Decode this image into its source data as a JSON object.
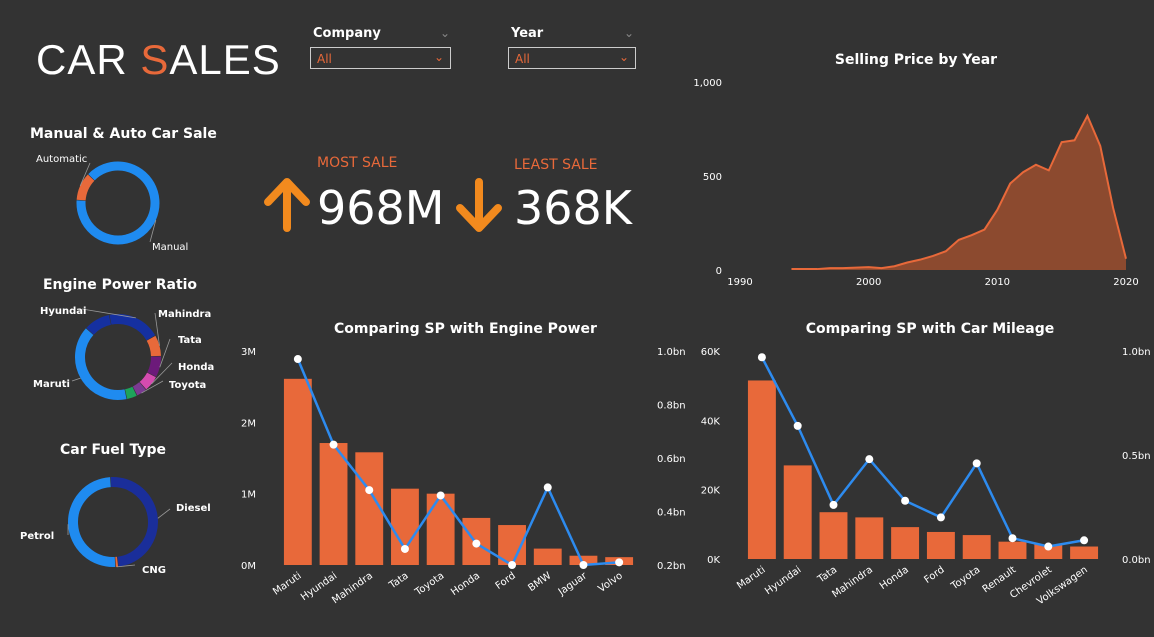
{
  "header": {
    "title_prefix": "CAR ",
    "title_accent": "S",
    "title_suffix": "ALES"
  },
  "slicers": {
    "company": {
      "label": "Company",
      "value": "All"
    },
    "year": {
      "label": "Year",
      "value": "All"
    }
  },
  "kpis": {
    "most": {
      "label": "MOST SALE",
      "value": "968M"
    },
    "least": {
      "label": "LEAST SALE",
      "value": "368K"
    }
  },
  "colors": {
    "accent": "#E8693A",
    "line": "#2D8BEF",
    "background": "#333333"
  },
  "chart_data": [
    {
      "id": "transmission",
      "type": "pie",
      "title": "Manual & Auto Car Sale",
      "slices": [
        {
          "label": "Manual",
          "value": 89,
          "color": "#1F8BF0"
        },
        {
          "label": "Automatic",
          "value": 11,
          "color": "#E8693A"
        }
      ]
    },
    {
      "id": "engine_power",
      "type": "pie",
      "title": "Engine Power Ratio",
      "slices": [
        {
          "label": "Hyundai",
          "value": 20,
          "color": "#1530A0"
        },
        {
          "label": "Mahindra",
          "value": 8,
          "color": "#E8693A"
        },
        {
          "label": "Tata",
          "value": 8,
          "color": "#6C1A7A"
        },
        {
          "label": "Honda",
          "value": 6,
          "color": "#D54BB0"
        },
        {
          "label": "Toyota",
          "value": 4,
          "color": "#7B3A92"
        },
        {
          "label": "",
          "value": 4,
          "color": "#1EA35B"
        },
        {
          "label": "Maruti",
          "value": 40,
          "color": "#1F8BF0"
        },
        {
          "label": "",
          "value": 10,
          "color": "#1530A0"
        }
      ]
    },
    {
      "id": "fuel",
      "type": "pie",
      "title": "Car Fuel Type",
      "slices": [
        {
          "label": "Diesel",
          "value": 49,
          "color": "#1A2E9A"
        },
        {
          "label": "CNG",
          "value": 1,
          "color": "#E8693A"
        },
        {
          "label": "Petrol",
          "value": 50,
          "color": "#1F8BF0"
        }
      ]
    },
    {
      "id": "price_by_year",
      "type": "area",
      "title": "Selling Price by Year",
      "xlim": [
        1990,
        2020
      ],
      "ylim": [
        0,
        1000
      ],
      "xticks": [
        "1990",
        "2000",
        "2010",
        "2020"
      ],
      "yticks": [
        "0",
        "500",
        "1,000"
      ],
      "x": [
        1994,
        1996,
        1997,
        1998,
        2000,
        2001,
        2002,
        2003,
        2004,
        2005,
        2006,
        2007,
        2008,
        2009,
        2010,
        2011,
        2012,
        2013,
        2014,
        2015,
        2016,
        2017,
        2018,
        2019,
        2020
      ],
      "y": [
        5,
        5,
        10,
        10,
        15,
        10,
        20,
        40,
        55,
        75,
        100,
        160,
        185,
        215,
        320,
        460,
        520,
        560,
        530,
        680,
        690,
        820,
        660,
        330,
        60
      ]
    },
    {
      "id": "sp_engine",
      "type": "bar",
      "title": "Comparing SP with Engine Power",
      "categories": [
        "Maruti",
        "Hyundai",
        "Mahindra",
        "Tata",
        "Toyota",
        "Honda",
        "Ford",
        "BMW",
        "Jaguar",
        "Volvo"
      ],
      "series": [
        {
          "values": [
            2610000,
            1710000,
            1580000,
            1070000,
            1000000,
            660000,
            560000,
            230000,
            130000,
            110000
          ],
          "axis": "left",
          "color": "#E8693A"
        },
        {
          "values": [
            0.97,
            0.65,
            0.48,
            0.26,
            0.46,
            0.28,
            0.2,
            0.49,
            0.2,
            0.21
          ],
          "axis": "right",
          "color": "#2D8BEF"
        }
      ],
      "ylim": [
        0,
        3000000
      ],
      "yticks": [
        "0M",
        "1M",
        "2M",
        "3M"
      ],
      "y2lim": [
        0.2,
        1.0
      ],
      "y2ticks": [
        "0.2bn",
        "0.4bn",
        "0.6bn",
        "0.8bn",
        "1.0bn"
      ]
    },
    {
      "id": "sp_mileage",
      "type": "bar",
      "title": "Comparing SP with Car Mileage",
      "categories": [
        "Maruti",
        "Hyundai",
        "Tata",
        "Mahindra",
        "Honda",
        "Ford",
        "Toyota",
        "Renault",
        "Chevrolet",
        "Volkswagen"
      ],
      "series": [
        {
          "values": [
            51500,
            27000,
            13500,
            12000,
            9200,
            7800,
            6900,
            5000,
            4200,
            3600
          ],
          "axis": "left",
          "color": "#E8693A"
        },
        {
          "values": [
            0.97,
            0.64,
            0.26,
            0.48,
            0.28,
            0.2,
            0.46,
            0.1,
            0.06,
            0.09
          ],
          "axis": "right",
          "color": "#2D8BEF"
        }
      ],
      "ylim": [
        0,
        60000
      ],
      "yticks": [
        "0K",
        "20K",
        "40K",
        "60K"
      ],
      "y2lim": [
        0,
        1.0
      ],
      "y2ticks": [
        "0.0bn",
        "0.5bn",
        "1.0bn"
      ]
    }
  ]
}
